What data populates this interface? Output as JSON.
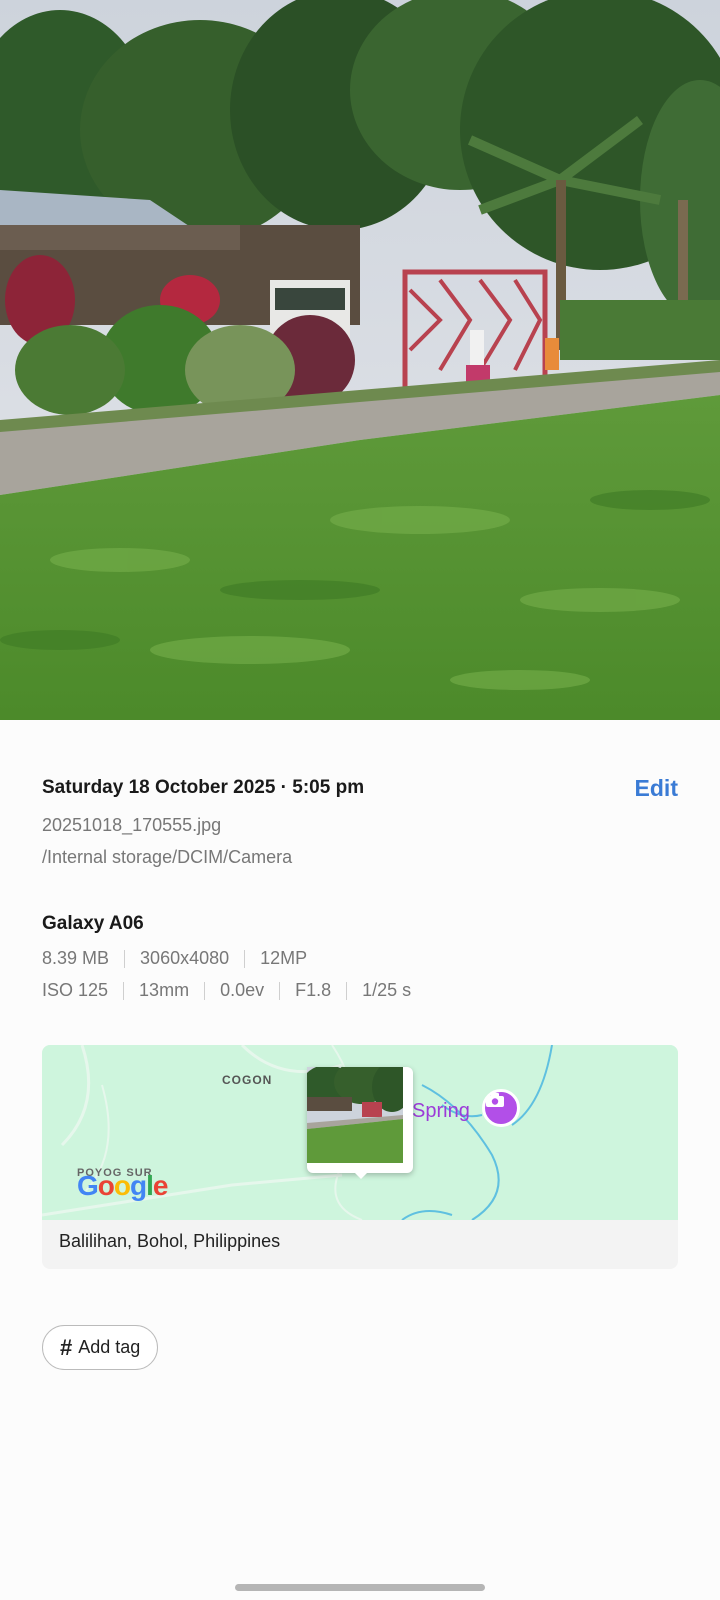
{
  "photo": {
    "description_icon": "photo-preview"
  },
  "details": {
    "date_time": "Saturday 18 October 2025 · 5:05 pm",
    "edit_label": "Edit",
    "filename": "20251018_170555.jpg",
    "path": "/Internal storage/DCIM/Camera",
    "device": "Galaxy A06",
    "specs_row1": [
      "8.39 MB",
      "3060x4080",
      "12MP"
    ],
    "specs_row2": [
      "ISO 125",
      "13mm",
      "0.0ev",
      "F1.8",
      "1/25 s"
    ]
  },
  "map": {
    "area_label": "COGON",
    "place_label": "Spring",
    "area_label_2": "POYOG SUR",
    "google_logo": "Google",
    "location": "Balilihan, Bohol, Philippines",
    "colors": {
      "map_bg": "#cef5dd",
      "river": "#5fc0e0",
      "place": "#9c3bd8"
    }
  },
  "tags": {
    "add_tag_label": "Add tag"
  },
  "colors": {
    "accent": "#3a7bd5"
  }
}
